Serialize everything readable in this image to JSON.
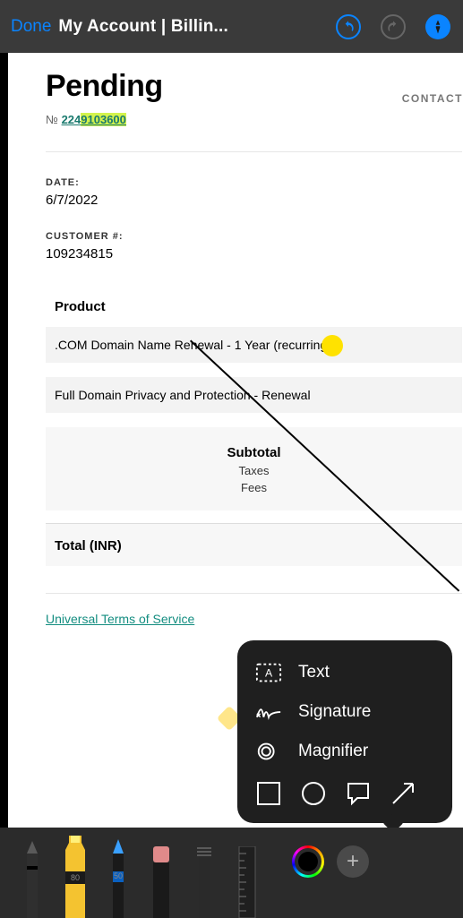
{
  "header": {
    "done": "Done",
    "title": "My Account | Billin..."
  },
  "invoice": {
    "status": "Pending",
    "contact": "CONTACT",
    "no_prefix": "№",
    "number_plain": "224",
    "number_hl": "9103600",
    "date_label": "DATE:",
    "date": "6/7/2022",
    "cust_label": "CUSTOMER #:",
    "cust": "109234815",
    "product_h": "Product",
    "rows": [
      ".COM Domain Name Renewal - 1 Year (recurring)",
      "Full Domain Privacy and Protection - Renewal"
    ],
    "subtotal": "Subtotal",
    "taxes": "Taxes",
    "fees": "Fees",
    "total": "Total (INR)",
    "tos": "Universal Terms of Service"
  },
  "popover": {
    "text": "Text",
    "signature": "Signature",
    "magnifier": "Magnifier"
  },
  "tools": {
    "hl_label": "80",
    "pen_label": "50"
  }
}
